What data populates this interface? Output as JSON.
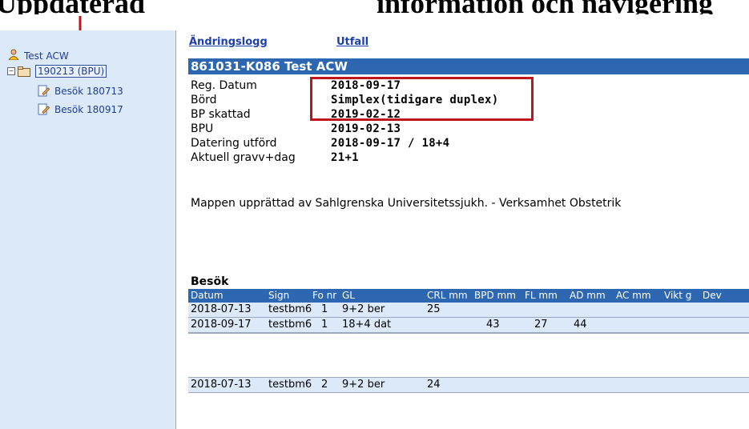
{
  "caption": {
    "left_text": "Uppdaterad",
    "right_text": "information och navigering"
  },
  "sidebar": {
    "root_label": "Test ACW",
    "patient_label": "190213 (BPU)",
    "visits": [
      "Besök 180713",
      "Besök 180917"
    ]
  },
  "links": {
    "log": "Ändringslogg",
    "outcome": "Utfall"
  },
  "header": {
    "title": "861031-K086 Test ACW"
  },
  "fields": [
    {
      "label": "Reg. Datum",
      "value": "2018-09-17"
    },
    {
      "label": "Börd",
      "value": "Simplex(tidigare duplex)"
    },
    {
      "label": "BP skattad",
      "value": "2019-02-12"
    },
    {
      "label": "BPU",
      "value": "2019-02-13"
    },
    {
      "label": "Datering utförd",
      "value": "2018-09-17 / 18+4"
    },
    {
      "label": "Aktuell gravv+dag",
      "value": "21+1"
    }
  ],
  "mappen": "Mappen upprättad av Sahlgrenska Universitetssjukh. - Verksamhet Obstetrik",
  "besok": {
    "title": "Besök",
    "columns": [
      "Datum",
      "Sign",
      "Fo nr",
      "GL",
      "CRL mm",
      "BPD mm",
      "FL mm",
      "AD mm",
      "AC mm",
      "Vikt g",
      "Dev"
    ],
    "rows": [
      [
        "2018-07-13",
        "testbm6",
        "1",
        "9+2 ber",
        "25",
        "",
        "",
        "",
        "",
        "",
        ""
      ],
      [
        "2018-09-17",
        "testbm6",
        "1",
        "18+4 dat",
        "",
        "43",
        "27",
        "44",
        "",
        "",
        ""
      ],
      [
        "2018-07-13",
        "testbm6",
        "2",
        "9+2 ber",
        "24",
        "",
        "",
        "",
        "",
        "",
        ""
      ]
    ]
  },
  "colors": {
    "header_blue": "#2d67b2",
    "sidebar_bg": "#dce9f8",
    "highlight_red": "#c0151a"
  }
}
